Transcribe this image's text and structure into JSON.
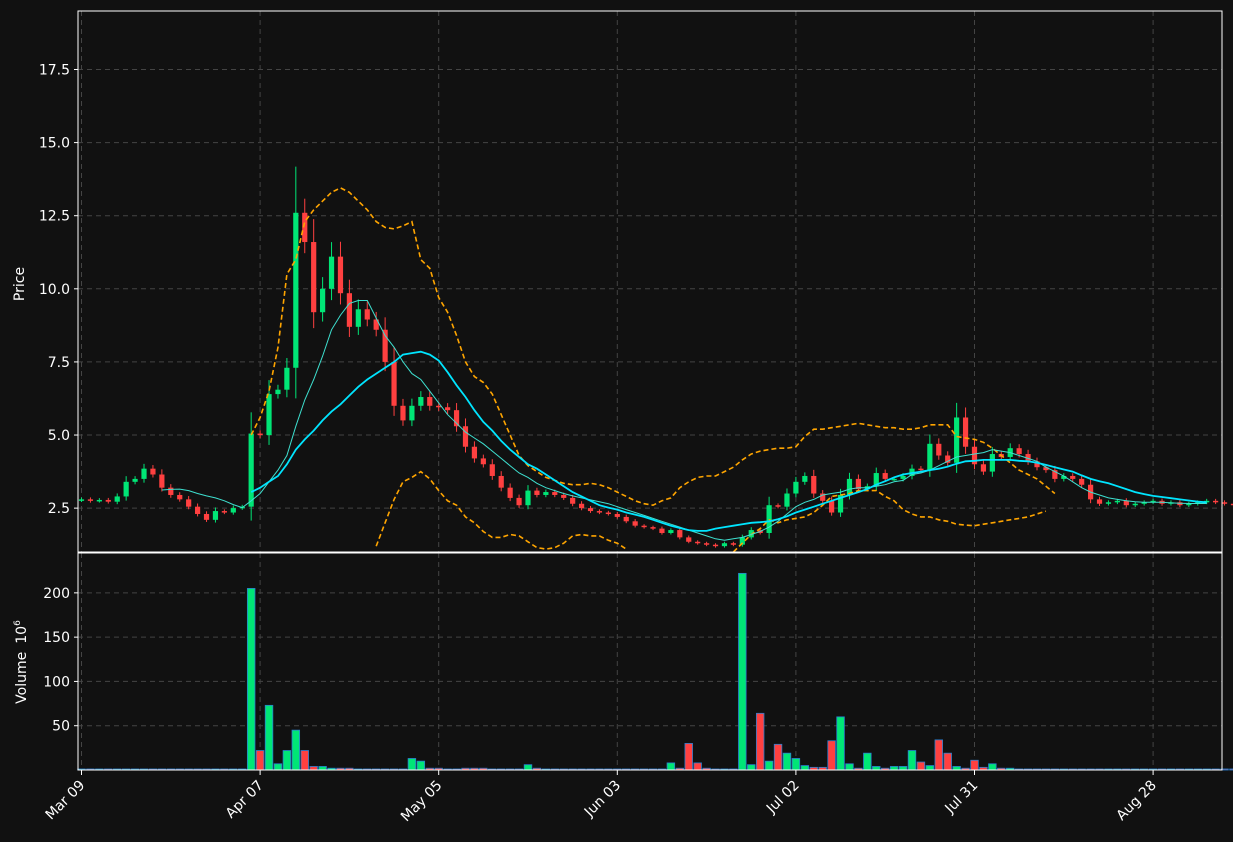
{
  "chart_data": {
    "type": "candlestick",
    "style": {
      "background": "#111111",
      "up_color": "#00e676",
      "down_color": "#ff4040",
      "ma_color": "#00e5ff",
      "bollinger_color": "#ffa500",
      "grid_color": "#444444",
      "text_color": "#ffffff"
    },
    "price_panel": {
      "ylabel": "Price",
      "yticks": [
        2.5,
        5.0,
        7.5,
        10.0,
        12.5,
        15.0,
        17.5
      ],
      "ylim": [
        1.0,
        19.5
      ],
      "grid": true
    },
    "volume_panel": {
      "ylabel": "Volume",
      "multiplier": "10",
      "multiplier_exp": "6",
      "yticks": [
        50,
        100,
        150,
        200
      ],
      "ylim": [
        0,
        245
      ],
      "grid": true
    },
    "x_axis": {
      "ticks": [
        {
          "label": "Mar 09",
          "index": 0
        },
        {
          "label": "Apr 07",
          "index": 20
        },
        {
          "label": "May 05",
          "index": 40
        },
        {
          "label": "Jun 03",
          "index": 60
        },
        {
          "label": "Jul 02",
          "index": 80
        },
        {
          "label": "Jul 31",
          "index": 100
        },
        {
          "label": "Aug 28",
          "index": 120
        }
      ],
      "count": 127
    },
    "close": [
      2.8,
      2.75,
      2.78,
      2.72,
      2.9,
      3.4,
      3.5,
      3.85,
      3.65,
      3.2,
      2.95,
      2.8,
      2.55,
      2.3,
      2.1,
      2.4,
      2.35,
      2.5,
      2.55,
      5.05,
      5.0,
      6.4,
      6.55,
      7.3,
      12.6,
      11.6,
      9.2,
      10.0,
      11.1,
      9.85,
      8.7,
      9.3,
      8.95,
      8.6,
      7.5,
      6.0,
      5.5,
      6.0,
      6.3,
      6.0,
      5.95,
      5.85,
      5.3,
      4.6,
      4.2,
      4.0,
      3.6,
      3.2,
      2.85,
      2.6,
      3.1,
      2.95,
      3.05,
      2.95,
      2.85,
      2.65,
      2.5,
      2.4,
      2.35,
      2.3,
      2.2,
      2.05,
      1.9,
      1.85,
      1.8,
      1.65,
      1.75,
      1.5,
      1.35,
      1.3,
      1.25,
      1.2,
      1.3,
      1.25,
      1.5,
      1.75,
      1.65,
      2.6,
      2.55,
      3.0,
      3.4,
      3.6,
      3.0,
      2.75,
      2.35,
      2.95,
      3.5,
      3.15,
      3.25,
      3.7,
      3.5,
      3.5,
      3.6,
      3.85,
      3.8,
      4.7,
      4.3,
      4.05,
      5.6,
      4.6,
      4.0,
      3.75,
      4.35,
      4.25,
      4.55,
      4.35,
      4.1,
      3.9,
      3.8,
      3.5,
      3.6,
      3.5,
      3.3,
      2.8,
      2.65,
      2.7,
      2.75,
      2.6,
      2.65,
      2.7,
      2.75,
      2.65,
      2.7,
      2.6,
      2.65,
      2.7,
      2.75,
      2.7,
      2.65,
      2.6,
      2.68
    ],
    "moving_averages": [
      {
        "period": 10,
        "values": [
          null,
          null,
          null,
          null,
          null,
          null,
          null,
          null,
          null,
          3.12,
          3.14,
          3.15,
          3.1,
          3.0,
          2.92,
          2.85,
          2.75,
          2.62,
          2.52,
          2.75,
          3.0,
          3.4,
          3.8,
          4.3,
          5.3,
          6.2,
          6.9,
          7.7,
          8.6,
          9.1,
          9.5,
          9.6,
          9.6,
          9.0,
          8.4,
          8.0,
          7.5,
          7.1,
          6.9,
          6.5,
          6.1,
          5.7,
          5.4,
          5.1,
          4.9,
          4.7,
          4.45,
          4.2,
          3.95,
          3.7,
          3.55,
          3.35,
          3.2,
          3.1,
          3.0,
          2.92,
          2.85,
          2.78,
          2.72,
          2.65,
          2.55,
          2.45,
          2.35,
          2.25,
          2.15,
          2.05,
          1.95,
          1.85,
          1.75,
          1.65,
          1.55,
          1.45,
          1.4,
          1.45,
          1.5,
          1.6,
          1.7,
          1.85,
          2.05,
          2.3,
          2.55,
          2.7,
          2.8,
          2.95,
          3.0,
          3.05,
          3.15,
          3.2,
          3.2,
          3.25,
          3.3,
          3.4,
          3.45,
          3.65,
          3.7,
          3.8,
          3.95,
          4.1,
          4.25,
          4.3,
          4.35,
          4.4,
          4.5,
          4.45,
          4.4,
          4.3,
          4.2,
          4.1,
          3.9,
          3.75,
          3.6,
          3.4,
          3.2,
          3.05,
          2.95,
          2.85,
          2.8,
          2.75,
          2.72,
          2.7,
          2.7,
          2.7,
          2.68,
          2.67,
          2.66,
          2.66,
          2.66
        ]
      },
      {
        "period": 20,
        "values": [
          null,
          null,
          null,
          null,
          null,
          null,
          null,
          null,
          null,
          null,
          null,
          null,
          null,
          null,
          null,
          null,
          null,
          null,
          null,
          3.05,
          3.2,
          3.4,
          3.6,
          4.0,
          4.5,
          4.85,
          5.15,
          5.5,
          5.8,
          6.05,
          6.35,
          6.65,
          6.9,
          7.1,
          7.3,
          7.5,
          7.75,
          7.8,
          7.85,
          7.75,
          7.55,
          7.15,
          6.7,
          6.3,
          5.85,
          5.45,
          5.15,
          4.8,
          4.5,
          4.25,
          4.0,
          3.85,
          3.65,
          3.45,
          3.25,
          3.05,
          2.9,
          2.75,
          2.6,
          2.52,
          2.45,
          2.35,
          2.28,
          2.2,
          2.1,
          2.0,
          1.9,
          1.82,
          1.75,
          1.72,
          1.72,
          1.8,
          1.85,
          1.9,
          1.95,
          2.0,
          2.02,
          2.05,
          2.12,
          2.22,
          2.35,
          2.45,
          2.55,
          2.65,
          2.75,
          2.85,
          2.95,
          3.05,
          3.15,
          3.3,
          3.42,
          3.55,
          3.65,
          3.7,
          3.75,
          3.8,
          3.85,
          3.92,
          4.02,
          4.1,
          4.12,
          4.15,
          4.15,
          4.15,
          4.15,
          4.12,
          4.1,
          4.05,
          3.98,
          3.9,
          3.82,
          3.75,
          3.62,
          3.5,
          3.42,
          3.35,
          3.25,
          3.15,
          3.05,
          2.98,
          2.92,
          2.88,
          2.84,
          2.8,
          2.76,
          2.72,
          2.7
        ]
      },
      {
        "name": "",
        "values": []
      }
    ],
    "bollinger_upper": [
      null,
      null,
      null,
      null,
      null,
      null,
      null,
      null,
      null,
      null,
      null,
      null,
      null,
      null,
      null,
      null,
      null,
      null,
      null,
      5.0,
      5.6,
      6.5,
      8.0,
      10.5,
      11.0,
      12.3,
      12.7,
      13.0,
      13.3,
      13.45,
      13.3,
      13.0,
      12.7,
      12.3,
      12.1,
      12.05,
      12.15,
      12.3,
      11.0,
      10.7,
      9.7,
      9.2,
      8.4,
      7.5,
      7.0,
      6.8,
      6.4,
      5.7,
      5.0,
      4.3,
      3.95,
      3.75,
      3.55,
      3.45,
      3.35,
      3.3,
      3.3,
      3.35,
      3.3,
      3.2,
      3.05,
      2.9,
      2.75,
      2.65,
      2.6,
      2.75,
      2.85,
      3.2,
      3.4,
      3.55,
      3.6,
      3.6,
      3.75,
      3.9,
      4.15,
      4.35,
      4.45,
      4.5,
      4.55,
      4.55,
      4.6,
      4.95,
      5.2,
      5.2,
      5.25,
      5.3,
      5.35,
      5.4,
      5.35,
      5.3,
      5.25,
      5.25,
      5.2,
      5.2,
      5.25,
      5.35,
      5.35,
      5.35,
      4.95,
      4.9,
      4.85,
      4.75,
      4.55,
      4.3,
      4.05,
      3.8,
      3.65,
      3.5,
      3.25,
      3.0
    ],
    "bollinger_lower": [
      null,
      null,
      null,
      null,
      null,
      null,
      null,
      null,
      null,
      null,
      null,
      null,
      null,
      null,
      null,
      null,
      null,
      null,
      null,
      1.45,
      0.9,
      0.5,
      0.2,
      0.1,
      0.1,
      0.1,
      0.1,
      0.1,
      0.1,
      0.1,
      0.1,
      0.1,
      0.5,
      1.2,
      2.0,
      2.8,
      3.4,
      3.55,
      3.75,
      3.5,
      3.1,
      2.75,
      2.6,
      2.2,
      2.0,
      1.7,
      1.5,
      1.5,
      1.6,
      1.55,
      1.35,
      1.15,
      1.1,
      1.15,
      1.3,
      1.55,
      1.6,
      1.55,
      1.55,
      1.4,
      1.3,
      1.1,
      0.9,
      0.7,
      0.6,
      0.5,
      0.5,
      0.5,
      0.5,
      0.5,
      0.5,
      0.5,
      0.7,
      1.0,
      1.3,
      1.6,
      1.8,
      2.1,
      2.0,
      2.1,
      2.15,
      2.2,
      2.35,
      2.6,
      2.9,
      2.95,
      3.0,
      3.1,
      3.1,
      3.1,
      2.9,
      2.75,
      2.45,
      2.3,
      2.2,
      2.2,
      2.1,
      2.05,
      1.95,
      1.92,
      1.9,
      1.95,
      2.0,
      2.05,
      2.1,
      2.15,
      2.2,
      2.3,
      2.4
    ],
    "volume": [
      0.5,
      0.4,
      0.3,
      0.4,
      0.5,
      0.6,
      0.5,
      0.4,
      0.4,
      0.4,
      0.3,
      0.3,
      0.3,
      0.3,
      0.4,
      0.3,
      0.3,
      0.3,
      0.4,
      205,
      22,
      73,
      7,
      22,
      45,
      22,
      4,
      4,
      2,
      2,
      2,
      1,
      1,
      1,
      1,
      1,
      1,
      13,
      10,
      2,
      2,
      1,
      1,
      2,
      2,
      2,
      1,
      1,
      1,
      1,
      6,
      2,
      1,
      1,
      1,
      1,
      1,
      1,
      1,
      1,
      1,
      1,
      1,
      1,
      1,
      1,
      8,
      2,
      30,
      8,
      2,
      1,
      1,
      0.5,
      222,
      6,
      64,
      10,
      29,
      19,
      13,
      5,
      3,
      3,
      33,
      60,
      7,
      2,
      19,
      4,
      2,
      4,
      4,
      22,
      9,
      5,
      34,
      19,
      4,
      2,
      11,
      3,
      7,
      2,
      2,
      1,
      1,
      1,
      1,
      1,
      1,
      1,
      1,
      1,
      1,
      1,
      1,
      1,
      1,
      1,
      1,
      1,
      1,
      1,
      1,
      1,
      1,
      1,
      0.5,
      0.5,
      0.5,
      0.5,
      0.5,
      1,
      1
    ]
  }
}
